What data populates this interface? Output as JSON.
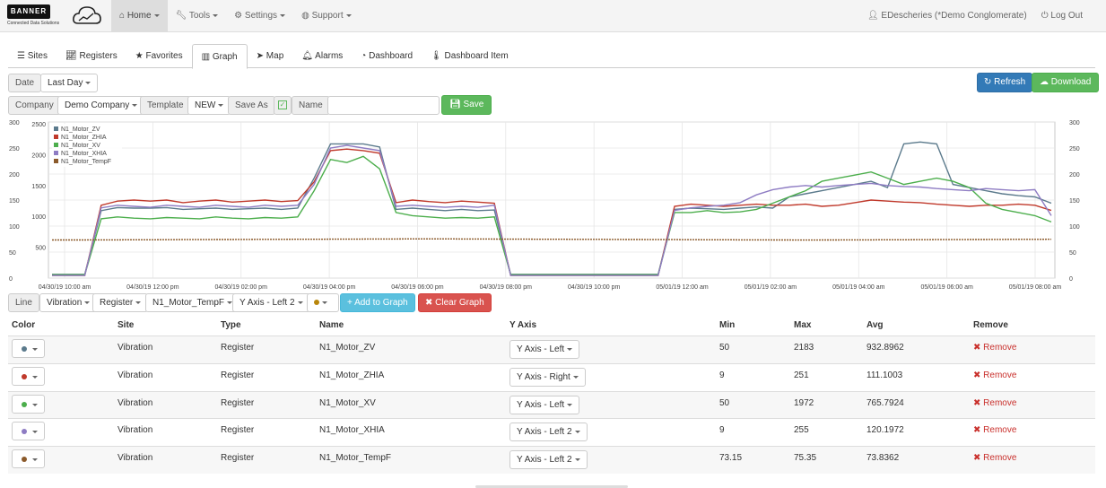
{
  "brand": {
    "logo_text": "BANNER",
    "logo_sub": "Connected Data Solutions"
  },
  "nav": {
    "items": [
      {
        "label": "Home",
        "icon": "home-icon"
      },
      {
        "label": "Tools",
        "icon": "wrench-icon"
      },
      {
        "label": "Settings",
        "icon": "gears-icon"
      },
      {
        "label": "Support",
        "icon": "globe-icon"
      }
    ],
    "user": "EDescheries (*Demo Conglomerate)",
    "logout": "Log Out"
  },
  "tabs": [
    {
      "label": "Sites",
      "icon": "list-icon"
    },
    {
      "label": "Registers",
      "icon": "area-chart-icon"
    },
    {
      "label": "Favorites",
      "icon": "star-icon"
    },
    {
      "label": "Graph",
      "icon": "bar-chart-icon"
    },
    {
      "label": "Map",
      "icon": "location-arrow-icon"
    },
    {
      "label": "Alarms",
      "icon": "bell-icon"
    },
    {
      "label": "Dashboard",
      "icon": "dashboard-icon"
    },
    {
      "label": "Dashboard Item",
      "icon": "thermometer-icon"
    }
  ],
  "filters": {
    "date_label": "Date",
    "date_value": "Last Day",
    "company_label": "Company",
    "company_value": "Demo Company",
    "template_label": "Template",
    "template_value": "NEW",
    "save_as_label": "Save As",
    "name_label": "Name",
    "name_value": "",
    "save_button": "Save",
    "refresh_button": "Refresh",
    "download_button": "Download"
  },
  "chart_data": {
    "type": "line",
    "left_axis_ticks": [
      "300",
      "250",
      "200",
      "150",
      "100",
      "50",
      "0"
    ],
    "left2_axis_ticks": [
      "2500",
      "2000",
      "1500",
      "1000",
      "500"
    ],
    "right_axis_ticks": [
      "300",
      "250",
      "200",
      "150",
      "100",
      "50",
      "0"
    ],
    "left2_range": [
      0,
      2500
    ],
    "right_range": [
      0,
      300
    ],
    "x_labels": [
      "04/30/19 10:00 am",
      "04/30/19 12:00 pm",
      "04/30/19 02:00 pm",
      "04/30/19 04:00 pm",
      "04/30/19 06:00 pm",
      "04/30/19 08:00 pm",
      "04/30/19 10:00 pm",
      "05/01/19 12:00 am",
      "05/01/19 02:00 am",
      "05/01/19 04:00 am",
      "05/01/19 06:00 am",
      "05/01/19 08:00 am"
    ],
    "legend_position": "top-left",
    "series": [
      {
        "name": "N1_Motor_ZV",
        "color": "#5b7a8c",
        "axis": "left2",
        "values": [
          60,
          60,
          60,
          1080,
          1130,
          1120,
          1120,
          1130,
          1100,
          1110,
          1120,
          1100,
          1110,
          1120,
          1100,
          1120,
          1600,
          2150,
          2150,
          2150,
          2100,
          1100,
          1120,
          1100,
          1080,
          1100,
          1080,
          1090,
          60,
          60,
          60,
          60,
          60,
          60,
          60,
          60,
          60,
          60,
          1100,
          1120,
          1110,
          1100,
          1120,
          1140,
          1120,
          1300,
          1350,
          1400,
          1450,
          1500,
          1550,
          1450,
          2150,
          2180,
          2150,
          1500,
          1450,
          1400,
          1350,
          1320,
          1300,
          1200
        ]
      },
      {
        "name": "N1_Motor_ZHIA",
        "color": "#c0392b",
        "axis": "right",
        "values": [
          5,
          5,
          5,
          140,
          148,
          150,
          148,
          150,
          145,
          148,
          150,
          146,
          148,
          150,
          147,
          149,
          185,
          245,
          248,
          245,
          240,
          145,
          150,
          147,
          145,
          148,
          146,
          144,
          5,
          5,
          5,
          5,
          5,
          5,
          5,
          5,
          5,
          5,
          138,
          142,
          140,
          138,
          140,
          142,
          140,
          140,
          142,
          138,
          140,
          145,
          150,
          148,
          146,
          145,
          142,
          140,
          138,
          140,
          140,
          142,
          140,
          130
        ]
      },
      {
        "name": "N1_Motor_XV",
        "color": "#4cae4c",
        "axis": "left2",
        "values": [
          55,
          55,
          55,
          950,
          980,
          960,
          950,
          970,
          960,
          950,
          980,
          960,
          950,
          970,
          960,
          980,
          1400,
          1900,
          1850,
          1950,
          1750,
          1050,
          1000,
          980,
          960,
          970,
          960,
          980,
          55,
          55,
          55,
          55,
          55,
          55,
          55,
          55,
          55,
          55,
          1050,
          1050,
          1080,
          1050,
          1060,
          1100,
          1200,
          1300,
          1400,
          1550,
          1600,
          1650,
          1700,
          1600,
          1500,
          1550,
          1600,
          1550,
          1450,
          1200,
          1100,
          1050,
          1000,
          900
        ]
      },
      {
        "name": "N1_Motor_XHIA",
        "color": "#8e7cc3",
        "axis": "right",
        "values": [
          5,
          5,
          5,
          135,
          140,
          138,
          136,
          140,
          138,
          136,
          140,
          138,
          136,
          140,
          138,
          140,
          180,
          250,
          255,
          250,
          245,
          138,
          140,
          138,
          136,
          138,
          136,
          140,
          5,
          5,
          5,
          5,
          5,
          5,
          5,
          5,
          5,
          5,
          130,
          135,
          138,
          140,
          145,
          160,
          170,
          175,
          178,
          175,
          178,
          180,
          182,
          178,
          176,
          175,
          172,
          170,
          168,
          172,
          170,
          168,
          170,
          120
        ]
      },
      {
        "name": "N1_Motor_TempF",
        "color": "#8b5a2b",
        "axis": "right",
        "values": [
          73.2,
          73.2,
          73.3,
          73.4,
          73.5,
          73.6,
          73.7,
          73.8,
          73.9,
          74,
          74.1,
          74.2,
          74.3,
          74.4,
          74.5,
          74.6,
          74.7,
          74.8,
          74.9,
          75,
          75.1,
          75.2,
          75.3,
          75.35,
          75.3,
          75.2,
          75.1,
          75,
          74.9,
          74.8,
          74.7,
          74.6,
          74.5,
          74.4,
          74.3,
          74.2,
          74.1,
          74,
          73.9,
          73.8,
          73.7,
          73.6,
          73.5,
          73.4,
          73.3,
          73.2,
          73.15,
          73.2,
          73.3,
          73.4,
          73.5,
          73.6,
          73.7,
          73.8,
          73.9,
          74,
          74.1,
          74.2,
          74.3,
          74.4,
          74.5,
          74.6
        ]
      }
    ]
  },
  "line_controls": {
    "line_label": "Line",
    "site_value": "Vibration",
    "type_value": "Register",
    "register_value": "N1_Motor_TempF",
    "axis_value": "Y Axis - Left 2",
    "color_value": "#b8860b",
    "add_button": "Add to Graph",
    "clear_button": "Clear Graph"
  },
  "table": {
    "headers": {
      "color": "Color",
      "site": "Site",
      "type": "Type",
      "name": "Name",
      "yaxis": "Y Axis",
      "min": "Min",
      "max": "Max",
      "avg": "Avg",
      "remove": "Remove"
    },
    "rows": [
      {
        "color": "#5b7a8c",
        "site": "Vibration",
        "type": "Register",
        "name": "N1_Motor_ZV",
        "yaxis": "Y Axis - Left",
        "min": "50",
        "max": "2183",
        "avg": "932.8962",
        "remove": "Remove"
      },
      {
        "color": "#c0392b",
        "site": "Vibration",
        "type": "Register",
        "name": "N1_Motor_ZHIA",
        "yaxis": "Y Axis - Right",
        "min": "9",
        "max": "251",
        "avg": "111.1003",
        "remove": "Remove"
      },
      {
        "color": "#4cae4c",
        "site": "Vibration",
        "type": "Register",
        "name": "N1_Motor_XV",
        "yaxis": "Y Axis - Left",
        "min": "50",
        "max": "1972",
        "avg": "765.7924",
        "remove": "Remove"
      },
      {
        "color": "#8e7cc3",
        "site": "Vibration",
        "type": "Register",
        "name": "N1_Motor_XHIA",
        "yaxis": "Y Axis - Left 2",
        "min": "9",
        "max": "255",
        "avg": "120.1972",
        "remove": "Remove"
      },
      {
        "color": "#8b5a2b",
        "site": "Vibration",
        "type": "Register",
        "name": "N1_Motor_TempF",
        "yaxis": "Y Axis - Left 2",
        "min": "73.15",
        "max": "75.35",
        "avg": "73.8362",
        "remove": "Remove"
      }
    ]
  }
}
